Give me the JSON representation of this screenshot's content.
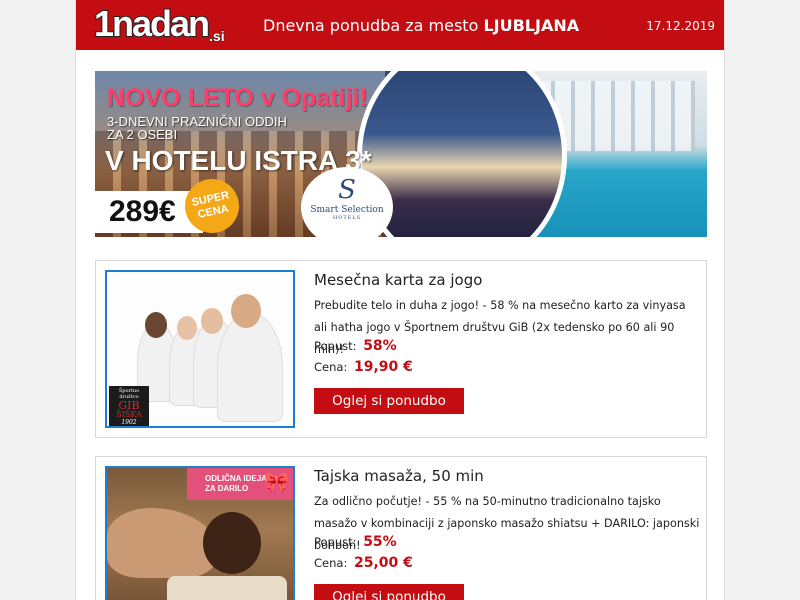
{
  "header": {
    "logo_main": "1nadan",
    "logo_si": ".si",
    "title_prefix": "Dnevna ponudba za mesto",
    "title_city": "LJUBLJANA",
    "date": "17.12.2019",
    "background_color": "#c40d12"
  },
  "banner": {
    "headline": "NOVO LETO v Opatiji!",
    "subline_1": "3-DNEVNI PRAZNIČNI ODDIH",
    "subline_2": "ZA 2 OSEBI",
    "hotel": "V HOTELU ISTRA 3*",
    "price": "289€",
    "badge_line_1": "SUPER",
    "badge_line_2": "CENA",
    "logo_name": "Smart Selection",
    "logo_sub": "HOTELS"
  },
  "offers": [
    {
      "title": "Mesečna karta za jogo",
      "description": "Prebudite telo in duha z jogo! - 58 % na mesečno karto za vinyasa ali hatha jogo v Športnem društvu GiB (2x tedensko po 60 ali 90 min)!",
      "discount_label": "Popust:",
      "discount_value": "58%",
      "price_label": "Cena:",
      "price_value": "19,90 €",
      "button_label": "Oglej si ponudbo",
      "image_logo_line_1": "Športno društvo",
      "image_logo_line_2": "GIB",
      "image_logo_line_3": "ŠIŠKA",
      "image_logo_line_4": "1902"
    },
    {
      "title": "Tajska masaža, 50 min",
      "description": "Za odlično počutje! - 55 % na 50-minutno tradicionalno tajsko masažo v kombinaciji z japonsko masažo shiatsu + DARILO: japonski bonbon!",
      "discount_label": "Popust:",
      "discount_value": "55%",
      "price_label": "Cena:",
      "price_value": "25,00 €",
      "button_label": "Oglej si ponudbo",
      "image_gift_line_1": "ODLIČNA IDEJA",
      "image_gift_line_2": "ZA DARILO"
    }
  ],
  "colors": {
    "accent": "#c40d12",
    "image_border": "#1e7fd0",
    "gift_badge": "#e3517a",
    "banner_headline": "#ff3d6a",
    "price_badge": "#f5a815"
  },
  "icons": {
    "gift": "gift-icon",
    "smart_selection": "smart-selection-logo-icon"
  }
}
